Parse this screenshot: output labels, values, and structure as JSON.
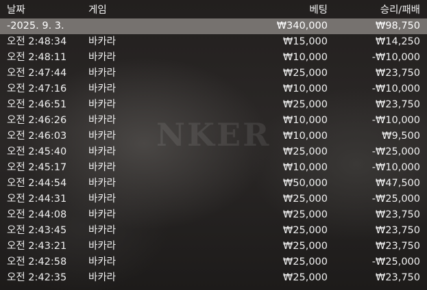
{
  "header": {
    "date": "날짜",
    "game": "게임",
    "bet": "베팅",
    "winloss": "승리/패배"
  },
  "background_watermark": "NKER",
  "subtotal": {
    "date": "-2025. 9. 3.",
    "bet": "₩340,000",
    "winloss": "₩98,750"
  },
  "rows": [
    {
      "time": "오전 2:48:34",
      "game": "바카라",
      "bet": "₩15,000",
      "winloss": "₩14,250"
    },
    {
      "time": "오전 2:48:11",
      "game": "바카라",
      "bet": "₩10,000",
      "winloss": "-₩10,000"
    },
    {
      "time": "오전 2:47:44",
      "game": "바카라",
      "bet": "₩25,000",
      "winloss": "₩23,750"
    },
    {
      "time": "오전 2:47:16",
      "game": "바카라",
      "bet": "₩10,000",
      "winloss": "-₩10,000"
    },
    {
      "time": "오전 2:46:51",
      "game": "바카라",
      "bet": "₩25,000",
      "winloss": "₩23,750"
    },
    {
      "time": "오전 2:46:26",
      "game": "바카라",
      "bet": "₩10,000",
      "winloss": "-₩10,000"
    },
    {
      "time": "오전 2:46:03",
      "game": "바카라",
      "bet": "₩10,000",
      "winloss": "₩9,500"
    },
    {
      "time": "오전 2:45:40",
      "game": "바카라",
      "bet": "₩25,000",
      "winloss": "-₩25,000"
    },
    {
      "time": "오전 2:45:17",
      "game": "바카라",
      "bet": "₩10,000",
      "winloss": "-₩10,000"
    },
    {
      "time": "오전 2:44:54",
      "game": "바카라",
      "bet": "₩50,000",
      "winloss": "₩47,500"
    },
    {
      "time": "오전 2:44:31",
      "game": "바카라",
      "bet": "₩25,000",
      "winloss": "-₩25,000"
    },
    {
      "time": "오전 2:44:08",
      "game": "바카라",
      "bet": "₩25,000",
      "winloss": "₩23,750"
    },
    {
      "time": "오전 2:43:45",
      "game": "바카라",
      "bet": "₩25,000",
      "winloss": "₩23,750"
    },
    {
      "time": "오전 2:43:21",
      "game": "바카라",
      "bet": "₩25,000",
      "winloss": "₩23,750"
    },
    {
      "time": "오전 2:42:58",
      "game": "바카라",
      "bet": "₩25,000",
      "winloss": "-₩25,000"
    },
    {
      "time": "오전 2:42:35",
      "game": "바카라",
      "bet": "₩25,000",
      "winloss": "₩23,750"
    }
  ]
}
